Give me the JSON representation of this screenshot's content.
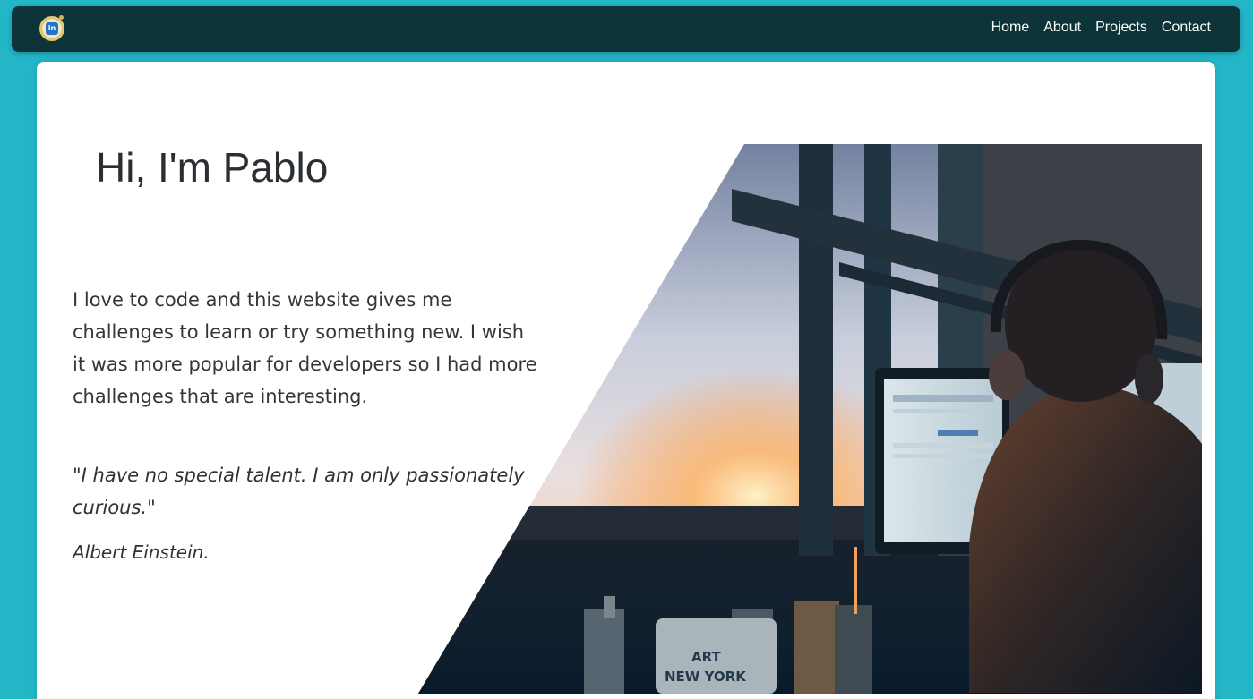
{
  "navbar": {
    "logo_icon": "linkedin-badge-icon",
    "logo_text": "in",
    "links": [
      "Home",
      "About",
      "Projects",
      "Contact"
    ]
  },
  "hero": {
    "title": "Hi, I'm Pablo",
    "intro": "I love to code and this website gives me challenges to learn or try something new. I wish it was more popular for developers so I had more challenges that are interesting.",
    "quote": "\"I have no special talent. I am only passionately curious.\"",
    "quote_author": "Albert Einstein.",
    "photo_icon": "developer-at-desk-photo",
    "photo_mug_text_1": "ART",
    "photo_mug_text_2": "NEW YORK"
  },
  "colors": {
    "page_background": "#23b6c7",
    "navbar_background": "#0c3439",
    "card_background": "#ffffff",
    "text": "#2b2f33"
  }
}
